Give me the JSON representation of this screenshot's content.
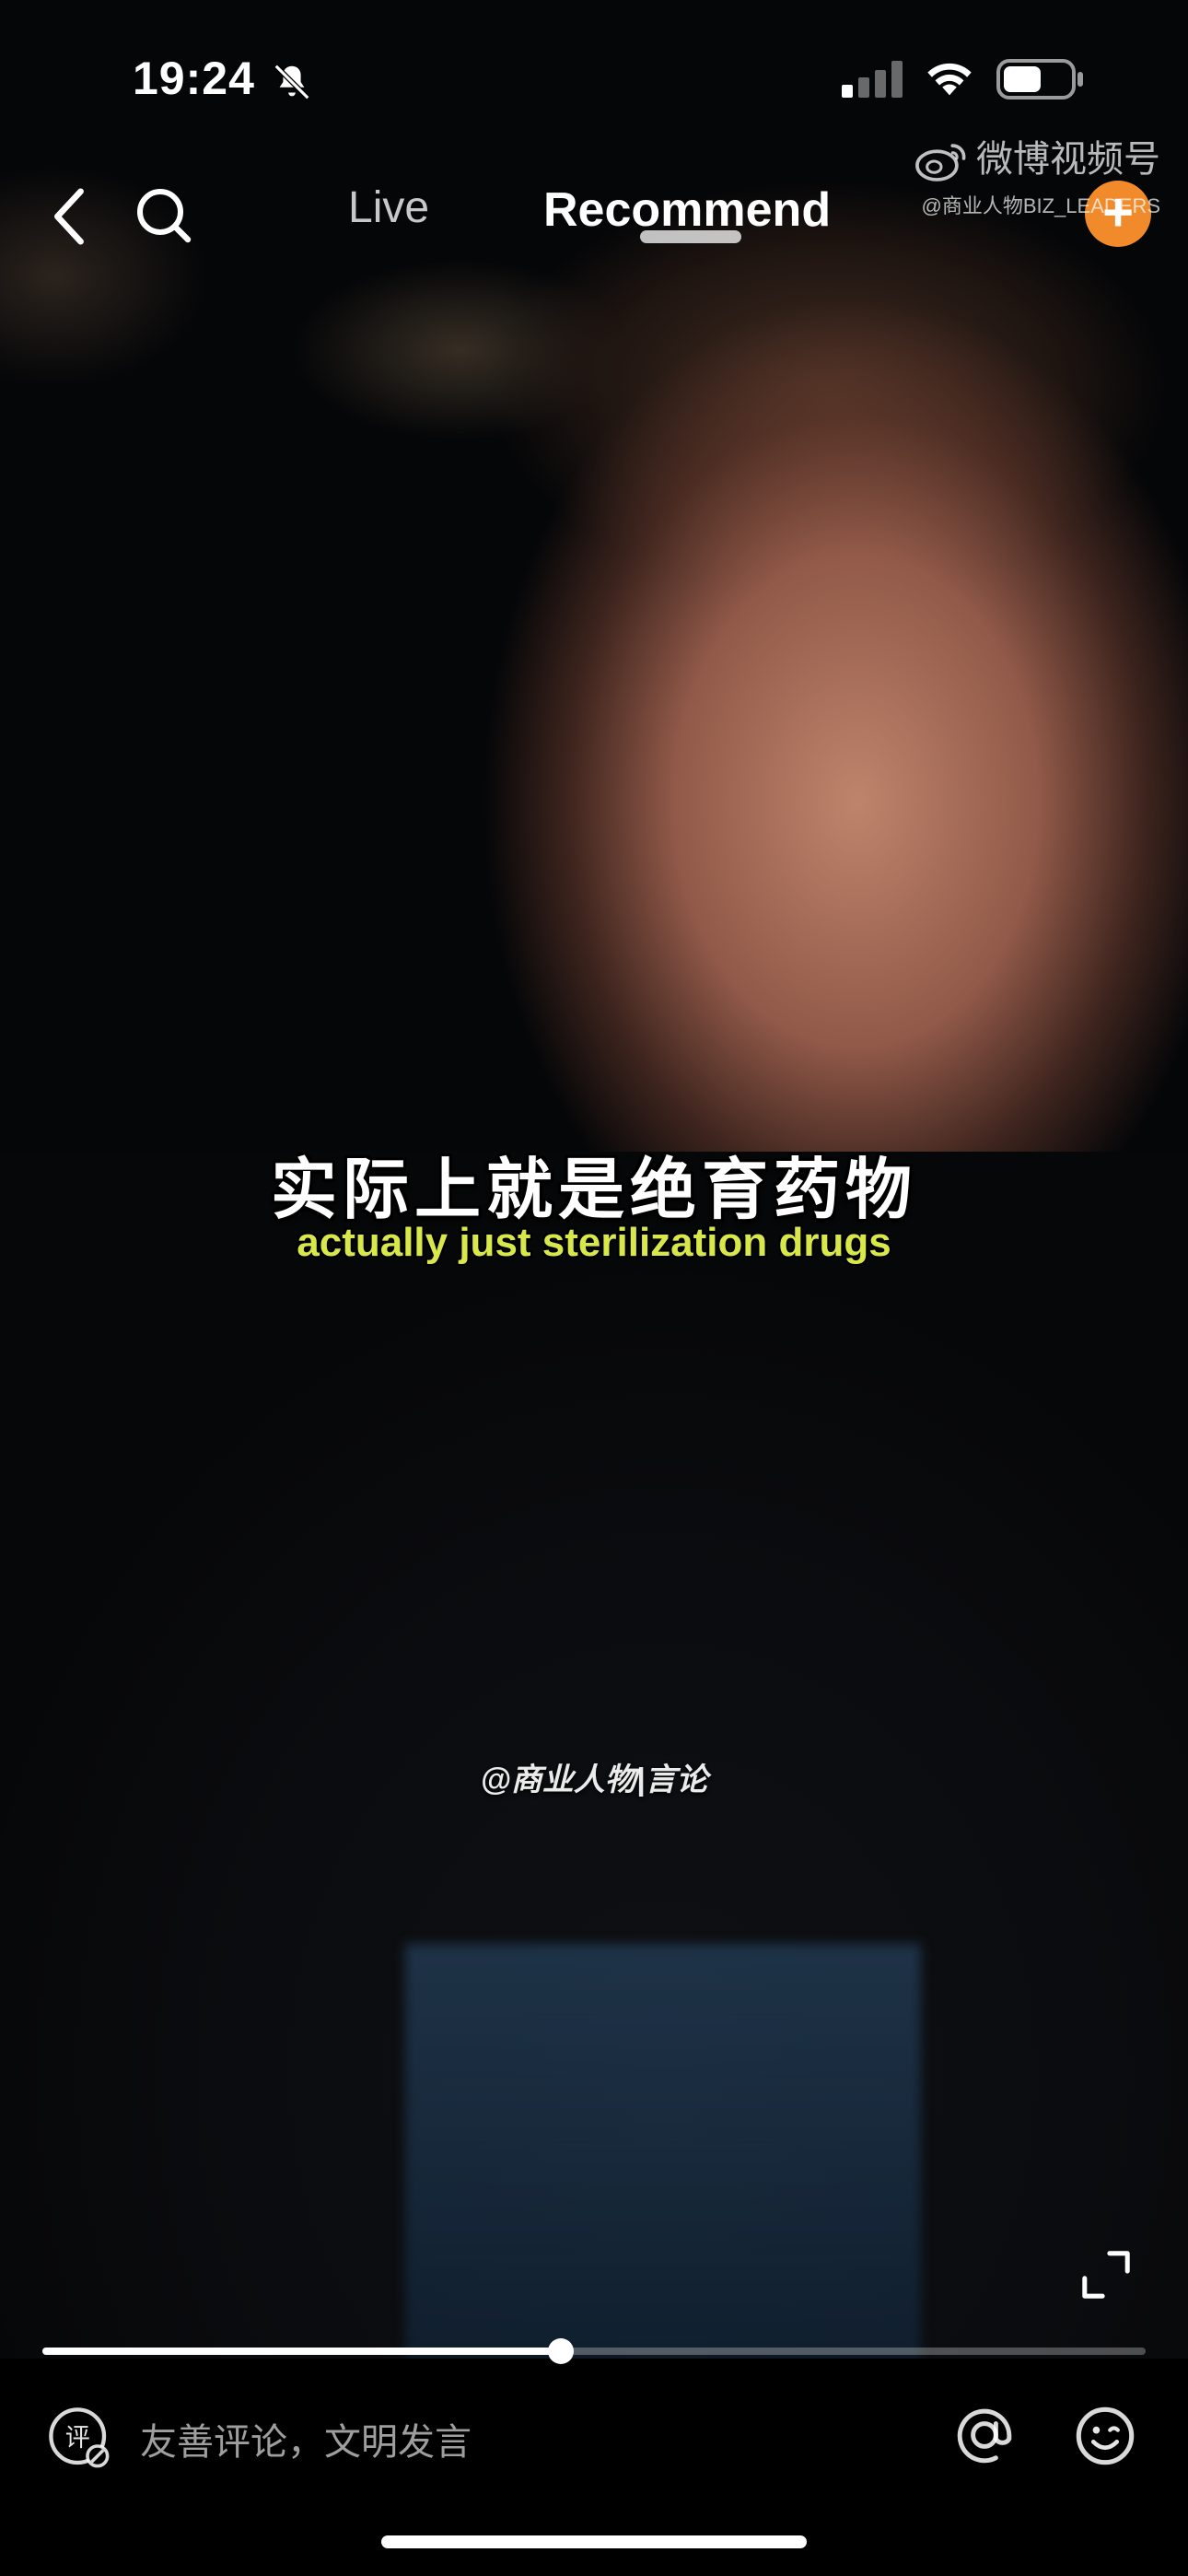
{
  "status_bar": {
    "time": "19:24"
  },
  "nav": {
    "tabs": [
      {
        "label": "Live",
        "active": false
      },
      {
        "label": "Recommend",
        "active": true
      }
    ],
    "add_label": "+"
  },
  "watermark": {
    "brand": "微博视频号",
    "handle": "@商业人物BIZ_LEADERS"
  },
  "video": {
    "subtitle_cn": "实际上就是绝育药物",
    "subtitle_en": "actually just sterilization drugs",
    "channel_handle": "@商业人物|言论",
    "progress_fraction": 0.47
  },
  "comment_bar": {
    "placeholder": "友善评论，文明发言",
    "comment_icon_char": "评"
  },
  "colors": {
    "accent": "#f08a2a",
    "subtitle_en": "#d8e84a"
  }
}
